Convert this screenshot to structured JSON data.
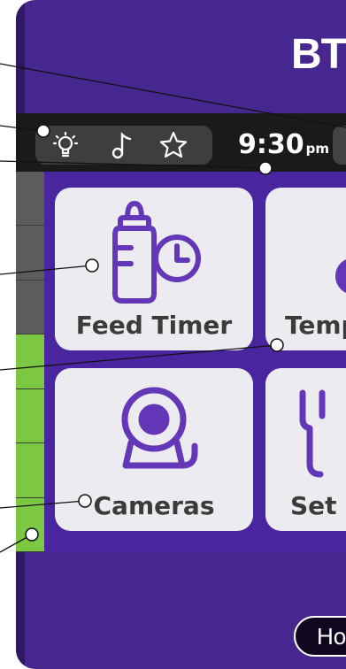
{
  "device": {
    "brand": "BT",
    "colors": {
      "body": "#46278f",
      "grid": "#4a25a0",
      "tile": "#ececf0",
      "icon": "#6436b8",
      "meter_green": "#7dc843"
    }
  },
  "status_bar": {
    "icons": [
      "lightbulb-icon",
      "music-note-icon",
      "star-icon"
    ],
    "time": "9:30",
    "ampm": "pm"
  },
  "sound_level": {
    "active_segments": 4,
    "total_segments": 7
  },
  "tiles": [
    {
      "label": "Feed Timer",
      "icon": "bottle-clock-icon"
    },
    {
      "label": "Temp",
      "icon": "thermometer-icon"
    },
    {
      "label": "Cameras",
      "icon": "camera-icon"
    },
    {
      "label": "Set",
      "icon": "wrench-icon"
    }
  ],
  "home_button": {
    "label": "Ho"
  }
}
